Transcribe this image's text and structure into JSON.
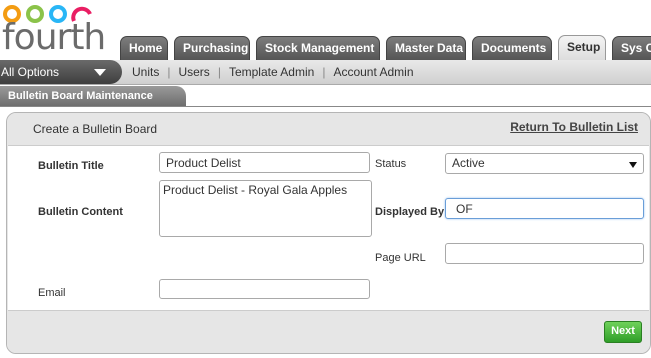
{
  "brand": {
    "logo_text": "fourth"
  },
  "tabs": [
    {
      "label": "Home"
    },
    {
      "label": "Purchasing"
    },
    {
      "label": "Stock Management"
    },
    {
      "label": "Master Data"
    },
    {
      "label": "Documents"
    },
    {
      "label": "Setup",
      "active": true
    },
    {
      "label": "Sys C"
    }
  ],
  "subnav": {
    "all_options": "All Options",
    "links": [
      "Units",
      "Users",
      "Template Admin",
      "Account Admin"
    ]
  },
  "breadcrumb": "Bulletin Board Maintenance",
  "panel": {
    "title": "Create a Bulletin Board",
    "return_link": "Return To Bulletin List"
  },
  "form": {
    "bulletin_title_label": "Bulletin Title",
    "bulletin_title_value": "Product Delist",
    "bulletin_content_label": "Bulletin Content",
    "bulletin_content_value": "Product Delist - Royal Gala Apples",
    "email_label": "Email",
    "email_value": "",
    "status_label": "Status",
    "status_value": "Active",
    "displayed_by_label": "Displayed By",
    "displayed_by_value": "OF",
    "page_url_label": "Page URL",
    "page_url_value": ""
  },
  "buttons": {
    "next": "Next"
  },
  "colors": {
    "next_green": "#3fb032",
    "tab_dark": "#666666",
    "focus_blue": "#6a9ed8"
  }
}
